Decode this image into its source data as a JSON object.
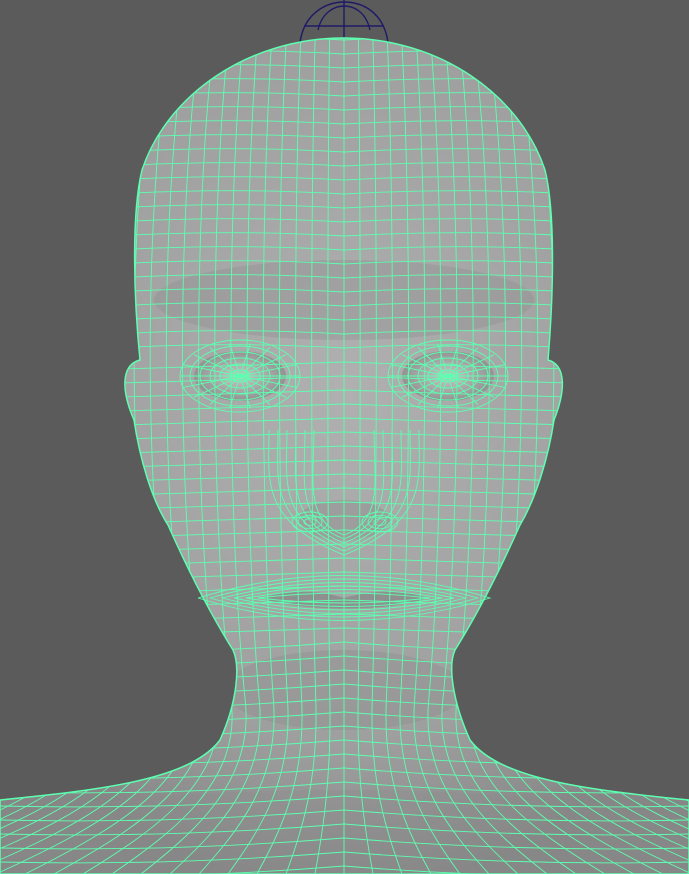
{
  "viewport": {
    "background_color": "#5b5b5b",
    "surface_color": "#a3a3a3",
    "wireframe_color": "#5dffb0",
    "pivot_color": "#1f1a66",
    "icon": "head-mesh-wireframe"
  }
}
